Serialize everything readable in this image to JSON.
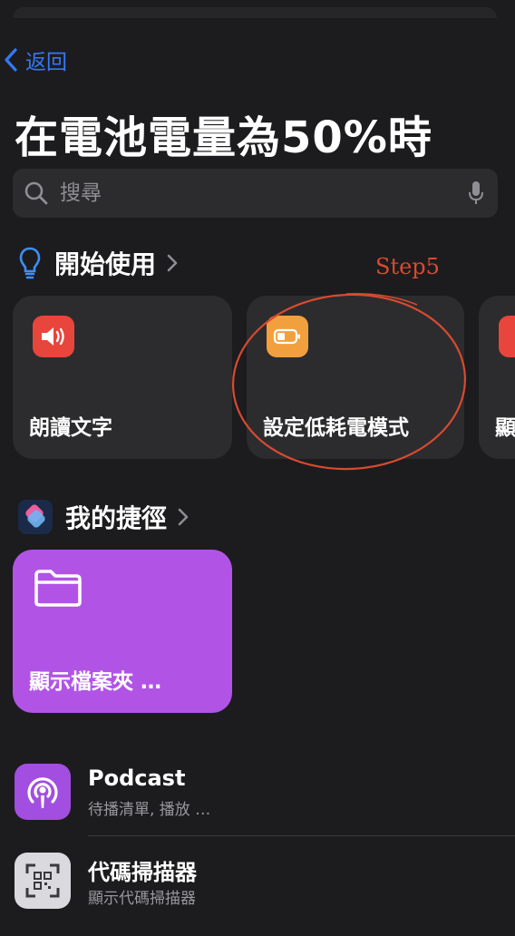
{
  "nav": {
    "back_label": "返回"
  },
  "page": {
    "title": "在電池電量為50%時"
  },
  "search": {
    "placeholder": "搜尋"
  },
  "get_started": {
    "label": "開始使用",
    "cards": [
      {
        "label": "朗讀文字",
        "icon": "speaker-icon",
        "color": "#e8453c"
      },
      {
        "label": "設定低耗電模式",
        "icon": "battery-icon",
        "color": "#f2a03d"
      },
      {
        "label": "顯",
        "icon": "bell-icon",
        "color": "#e8453c"
      }
    ]
  },
  "annotation": {
    "text": "Step5",
    "color": "#d84a30"
  },
  "my_shortcuts": {
    "label": "我的捷徑",
    "cards": [
      {
        "label": "顯示檔案夾 …",
        "icon": "folder-icon",
        "color": "#b154e6"
      }
    ]
  },
  "apps": [
    {
      "name": "Podcast",
      "subtitle": "待播清單, 播放 …",
      "icon": "podcast-icon",
      "color": "#a24ee0"
    },
    {
      "name": "代碼掃描器",
      "subtitle": "顯示代碼掃描器",
      "icon": "qr-scanner-icon",
      "color": "#d9d9de"
    }
  ]
}
